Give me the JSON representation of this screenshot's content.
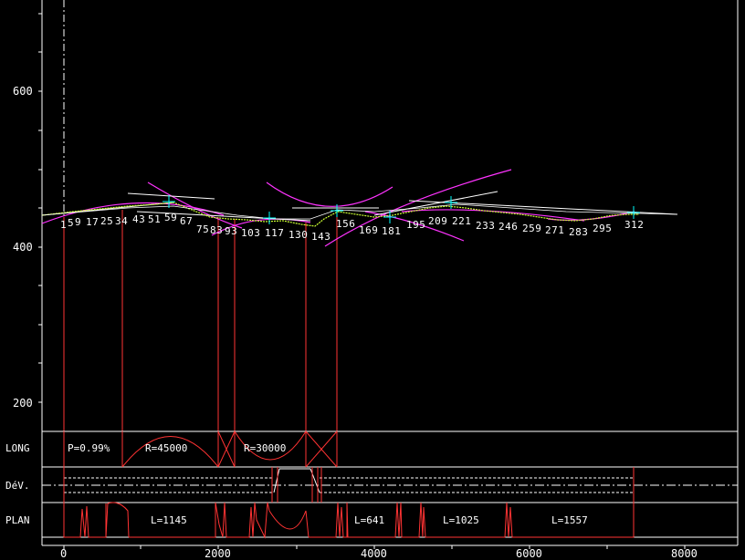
{
  "y_axis": {
    "ticks": [
      {
        "value": 600,
        "label": "600"
      },
      {
        "value": 400,
        "label": "400"
      },
      {
        "value": 200,
        "label": "200"
      }
    ]
  },
  "x_axis": {
    "ticks": [
      {
        "value": 0,
        "label": "0"
      },
      {
        "value": 2000,
        "label": "2000"
      },
      {
        "value": 4000,
        "label": "4000"
      },
      {
        "value": 6000,
        "label": "6000"
      },
      {
        "value": 8000,
        "label": "8000"
      }
    ]
  },
  "stations": [
    "1",
    "5",
    "9",
    "17",
    "25",
    "34",
    "43",
    "51",
    "59",
    "67",
    "75",
    "83",
    "93",
    "103",
    "117",
    "130",
    "143",
    "156",
    "169",
    "181",
    "195",
    "209",
    "221",
    "233",
    "246",
    "259",
    "271",
    "283",
    "295",
    "312"
  ],
  "bands": {
    "long": {
      "label": "LONG",
      "slope_text": "P=0.99%",
      "radius_1": "R=45000",
      "radius_2": "R=30000"
    },
    "dev": {
      "label": "DéV."
    },
    "plan": {
      "label": "PLAN",
      "lengths": [
        "L=1145",
        "L=641",
        "L=1025",
        "L=1557"
      ]
    }
  },
  "colors": {
    "background": "#000000",
    "grid": "#ffffff",
    "design": "#ff3333",
    "curve": "#ff33ff",
    "terrain": "#ccff33",
    "points": "#00ffff"
  }
}
